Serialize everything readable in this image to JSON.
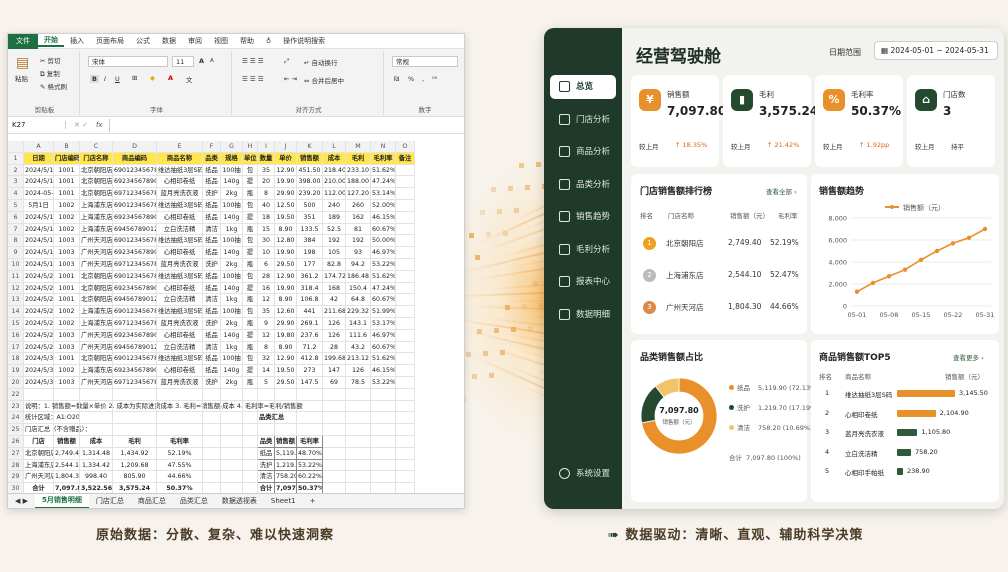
{
  "excel": {
    "menu": [
      "文件",
      "开始",
      "插入",
      "页面布局",
      "公式",
      "数据",
      "审阅",
      "视图",
      "帮助",
      "操作说明搜索"
    ],
    "ribbon": {
      "paste": "粘贴",
      "cut": "剪切",
      "copy": "复制",
      "format_painter": "格式刷",
      "clipboard": "剪贴板",
      "font_name": "宋体",
      "font_size": "11",
      "font_group": "字体",
      "wrap": "自动换行",
      "merge": "合并后居中",
      "align_group": "对齐方式",
      "number_format": "常规",
      "number_group": "数字",
      "bold": "B",
      "italic": "I",
      "underline": "U",
      "grow": "A",
      "shrink": "A",
      "percent": "%",
      "comma": ","
    },
    "name_box": "K27",
    "fx": "fx",
    "columns": [
      "A",
      "B",
      "C",
      "D",
      "E",
      "F",
      "G",
      "H",
      "I",
      "J",
      "K",
      "L",
      "M",
      "N"
    ],
    "header": [
      "日期",
      "门店编码",
      "门店名称",
      "商品编码",
      "商品名称",
      "品类",
      "规格",
      "单位",
      "数量",
      "单价",
      "销售额",
      "成本",
      "毛利",
      "毛利率",
      "备注"
    ],
    "rows": [
      [
        "2024/5/1",
        "1001",
        "北京朝阳店",
        "6901234567890",
        "维达抽纸3层S码",
        "纸品",
        "100抽",
        "包",
        "35",
        "12.90",
        "451.50",
        "218.40",
        "233.10",
        "51.62%",
        ""
      ],
      [
        "2024/5/1",
        "1001",
        "北京朝阳店",
        "6923456789012",
        "心相印卷纸",
        "纸品",
        "140g",
        "提",
        "20",
        "19.90",
        "398.00",
        "210.00",
        "188.00",
        "47.24%",
        ""
      ],
      [
        "2024-05-01",
        "1001",
        "北京朝阳店",
        "6971234567895",
        "蓝月亮洗衣液",
        "洗护",
        "2kg",
        "瓶",
        "8",
        "29.90",
        "239.20",
        "112.00",
        "127.20",
        "53.14%",
        ""
      ],
      [
        "5月1日",
        "1002",
        "上海浦东店",
        "6901234567890",
        "维达抽纸3层S码",
        "纸品",
        "100抽",
        "包",
        "40",
        "12.50",
        "500",
        "240",
        "260",
        "52.00%",
        ""
      ],
      [
        "2024/5/1",
        "1002",
        "上海浦东店",
        "6923456789012",
        "心相印卷纸",
        "纸品",
        "140g",
        "提",
        "18",
        "19.50",
        "351",
        "189",
        "162",
        "46.15%",
        ""
      ],
      [
        "2024/5/1",
        "1002",
        "上海浦东店",
        "6945678901234",
        "立白洗洁精",
        "清洁",
        "1kg",
        "瓶",
        "15",
        "8.90",
        "133.5",
        "52.5",
        "81",
        "60.67%",
        ""
      ],
      [
        "2024/5/1",
        "1003",
        "广州天河店",
        "6901234567890",
        "维达抽纸3层S码",
        "纸品",
        "100抽",
        "包",
        "30",
        "12.80",
        "384",
        "192",
        "192",
        "50.00%",
        ""
      ],
      [
        "2024/5/1",
        "1003",
        "广州天河店",
        "6923456789012",
        "心相印卷纸",
        "纸品",
        "140g",
        "提",
        "10",
        "19.90",
        "198",
        "105",
        "93",
        "46.97%",
        ""
      ],
      [
        "2024/5/1",
        "1003",
        "广州天河店",
        "6971234567895",
        "蓝月亮洗衣液",
        "洗护",
        "2kg",
        "瓶",
        "6",
        "29.50",
        "177",
        "82.8",
        "94.2",
        "53.22%",
        ""
      ],
      [
        "2024/5/2",
        "1001",
        "北京朝阳店",
        "6901234567890",
        "维达抽纸3层S码",
        "纸品",
        "100抽",
        "包",
        "28",
        "12.90",
        "361.2",
        "174.72",
        "186.48",
        "51.62%",
        ""
      ],
      [
        "2024/5/2",
        "1001",
        "北京朝阳店",
        "6923456789012",
        "心相印卷纸",
        "纸品",
        "140g",
        "提",
        "16",
        "19.90",
        "318.4",
        "168",
        "150.4",
        "47.24%",
        ""
      ],
      [
        "2024/5/2",
        "1001",
        "北京朝阳店",
        "6945678901234",
        "立白洗洁精",
        "清洁",
        "1kg",
        "瓶",
        "12",
        "8.90",
        "106.8",
        "42",
        "64.8",
        "60.67%",
        ""
      ],
      [
        "2024/5/2",
        "1002",
        "上海浦东店",
        "6901234567890",
        "维达抽纸3层S码",
        "纸品",
        "100抽",
        "包",
        "35",
        "12.60",
        "441",
        "211.68",
        "229.32",
        "51.99%",
        ""
      ],
      [
        "2024/5/2",
        "1002",
        "上海浦东店",
        "6971234567895",
        "蓝月亮洗衣液",
        "洗护",
        "2kg",
        "瓶",
        "9",
        "29.90",
        "269.1",
        "126",
        "143.1",
        "53.17%",
        ""
      ],
      [
        "2024/5/2",
        "1003",
        "广州天河店",
        "6923456789012",
        "心相印卷纸",
        "纸品",
        "140g",
        "提",
        "12",
        "19.80",
        "237.6",
        "126",
        "111.6",
        "46.97%",
        ""
      ],
      [
        "2024/5/2",
        "1003",
        "广州天河店",
        "6945678901234",
        "立白洗洁精",
        "清洁",
        "1kg",
        "瓶",
        "8",
        "8.90",
        "71.2",
        "28",
        "43.2",
        "60.67%",
        ""
      ],
      [
        "2024/5/3",
        "1001",
        "北京朝阳店",
        "6901234567890",
        "维达抽纸3层S码",
        "纸品",
        "100抽",
        "包",
        "32",
        "12.90",
        "412.8",
        "199.68",
        "213.12",
        "51.62%",
        ""
      ],
      [
        "2024/5/3",
        "1002",
        "上海浦东店",
        "6923456789012",
        "心相印卷纸",
        "纸品",
        "140g",
        "提",
        "14",
        "19.50",
        "273",
        "147",
        "126",
        "46.15%",
        ""
      ],
      [
        "2024/5/3",
        "1003",
        "广州天河店",
        "6971234567895",
        "蓝月亮洗衣液",
        "洗护",
        "2kg",
        "瓶",
        "5",
        "29.50",
        "147.5",
        "69",
        "78.5",
        "53.22%",
        ""
      ]
    ],
    "note": "说明：1. 销售额=数量×单价    2. 成本为实际进货成本    3. 毛利=销售额-成本    4. 毛利率=毛利/销售额",
    "stat_range": "统计区域：A1:O20",
    "store_summary_title": "门店汇总（不含赠品）：",
    "store_head": [
      "门店",
      "销售额",
      "成本",
      "毛利",
      "毛利率"
    ],
    "store_rows": [
      [
        "北京朝阳店",
        "2,749.40",
        "1,314.48",
        "1,434.92",
        "52.19%"
      ],
      [
        "上海浦东店",
        "2,544.10",
        "1,334.42",
        "1,209.68",
        "47.55%"
      ],
      [
        "广州天河店",
        "1,804.30",
        "998.40",
        "805.90",
        "44.66%"
      ],
      [
        "合计",
        "7,097.80",
        "3,522.56",
        "3,575.24",
        "50.37%"
      ]
    ],
    "cat_summary_title": "品类汇总",
    "cat_head": [
      "品类",
      "销售额",
      "毛利率"
    ],
    "cat_rows": [
      [
        "纸品",
        "5,119.90",
        "48.70%"
      ],
      [
        "洗护",
        "1,219.70",
        "53.22%"
      ],
      [
        "清洁",
        "758.20",
        "60.22%"
      ],
      [
        "合计",
        "7,097.80",
        "50.37%"
      ]
    ],
    "sheets": [
      "5月销售明细",
      "门店汇总",
      "商品汇总",
      "品类汇总",
      "数据透视表",
      "Sheet1",
      "+"
    ]
  },
  "caption_left": "原始数据：分散、复杂、难以快速洞察",
  "caption_right": "数据驱动：清晰、直观、辅助科学决策",
  "dashboard": {
    "title": "经营驾驶舱",
    "date_label": "日期范围",
    "date_range": "2024-05-01 ~ 2024-05-31",
    "nav": [
      "总览",
      "门店分析",
      "商品分析",
      "品类分析",
      "销售趋势",
      "毛利分析",
      "报表中心",
      "数据明细"
    ],
    "settings": "系统设置",
    "kpis": [
      {
        "label": "销售额",
        "value": "7,097.80",
        "compare": "较上月",
        "change": "↑ 18.35%",
        "color": "#e8902a",
        "icon": "¥"
      },
      {
        "label": "毛利",
        "value": "3,575.24",
        "compare": "较上月",
        "change": "↑ 21.42%",
        "color": "#24492f",
        "icon": "▮"
      },
      {
        "label": "毛利率",
        "value": "50.37%",
        "compare": "较上月",
        "change": "↑ 1.92pp",
        "color": "#e8902a",
        "icon": "%"
      },
      {
        "label": "门店数",
        "value": "3",
        "compare": "较上月",
        "change": "持平",
        "color": "#24492f",
        "icon": "⌂"
      }
    ],
    "rank": {
      "title": "门店销售额排行榜",
      "more": "查看全部 ›",
      "head": [
        "排名",
        "门店名称",
        "销售额（元）",
        "毛利率"
      ],
      "rows": [
        [
          "1",
          "北京朝阳店",
          "2,749.40",
          "52.19%"
        ],
        [
          "2",
          "上海浦东店",
          "2,544.10",
          "52.47%"
        ],
        [
          "3",
          "广州天河店",
          "1,804.30",
          "44.66%"
        ]
      ]
    },
    "pie": {
      "title": "品类销售额占比",
      "center_value": "7,097.80",
      "center_label": "销售额（元）",
      "items": [
        {
          "name": "纸品",
          "value": "5,119.90",
          "pct": "(72.13%)",
          "share": 72.13,
          "color": "#e8902a"
        },
        {
          "name": "洗护",
          "value": "1,219.70",
          "pct": "(17.19%)",
          "share": 17.19,
          "color": "#24492f"
        },
        {
          "name": "清洁",
          "value": "758.20",
          "pct": "(10.69%)",
          "share": 10.69,
          "color": "#f2c46a"
        }
      ],
      "total_label": "合计",
      "total_value": "7,097.80",
      "total_pct": "(100%)"
    },
    "top5": {
      "title": "商品销售额TOP5",
      "more": "查看更多 ›",
      "head": [
        "排名",
        "商品名称",
        "销售额（元）"
      ],
      "rows": [
        {
          "rank": "1",
          "name": "维达抽纸3层S码",
          "value": "3,145.50",
          "num": 3145.5,
          "color": "#e8902a"
        },
        {
          "rank": "2",
          "name": "心相印卷纸",
          "value": "2,104.90",
          "num": 2104.9,
          "color": "#e8902a"
        },
        {
          "rank": "3",
          "name": "蓝月亮洗衣液",
          "value": "1,105.80",
          "num": 1105.8,
          "color": "#2e5a3a"
        },
        {
          "rank": "4",
          "name": "立白洗洁精",
          "value": "758.20",
          "num": 758.2,
          "color": "#2e5a3a"
        },
        {
          "rank": "5",
          "name": "心相印手帕纸",
          "value": "238.90",
          "num": 238.9,
          "color": "#2e5a3a"
        }
      ]
    }
  },
  "chart_data": {
    "type": "line",
    "title": "销售额趋势",
    "series": [
      {
        "name": "销售额（元）",
        "values": [
          1300,
          2100,
          2700,
          3300,
          4200,
          5000,
          5700,
          6200,
          7000
        ]
      }
    ],
    "x": [
      "05-01",
      "05-05",
      "05-08",
      "05-12",
      "05-15",
      "05-19",
      "05-22",
      "05-26",
      "05-31"
    ],
    "xticks": [
      "05-01",
      "05-08",
      "05-15",
      "05-22",
      "05-31"
    ],
    "yticks": [
      "0",
      "2,000",
      "4,000",
      "6,000",
      "8,000"
    ],
    "ylim": [
      0,
      8000
    ],
    "grid": true,
    "legend": "top-center",
    "color": "#e8902a"
  }
}
